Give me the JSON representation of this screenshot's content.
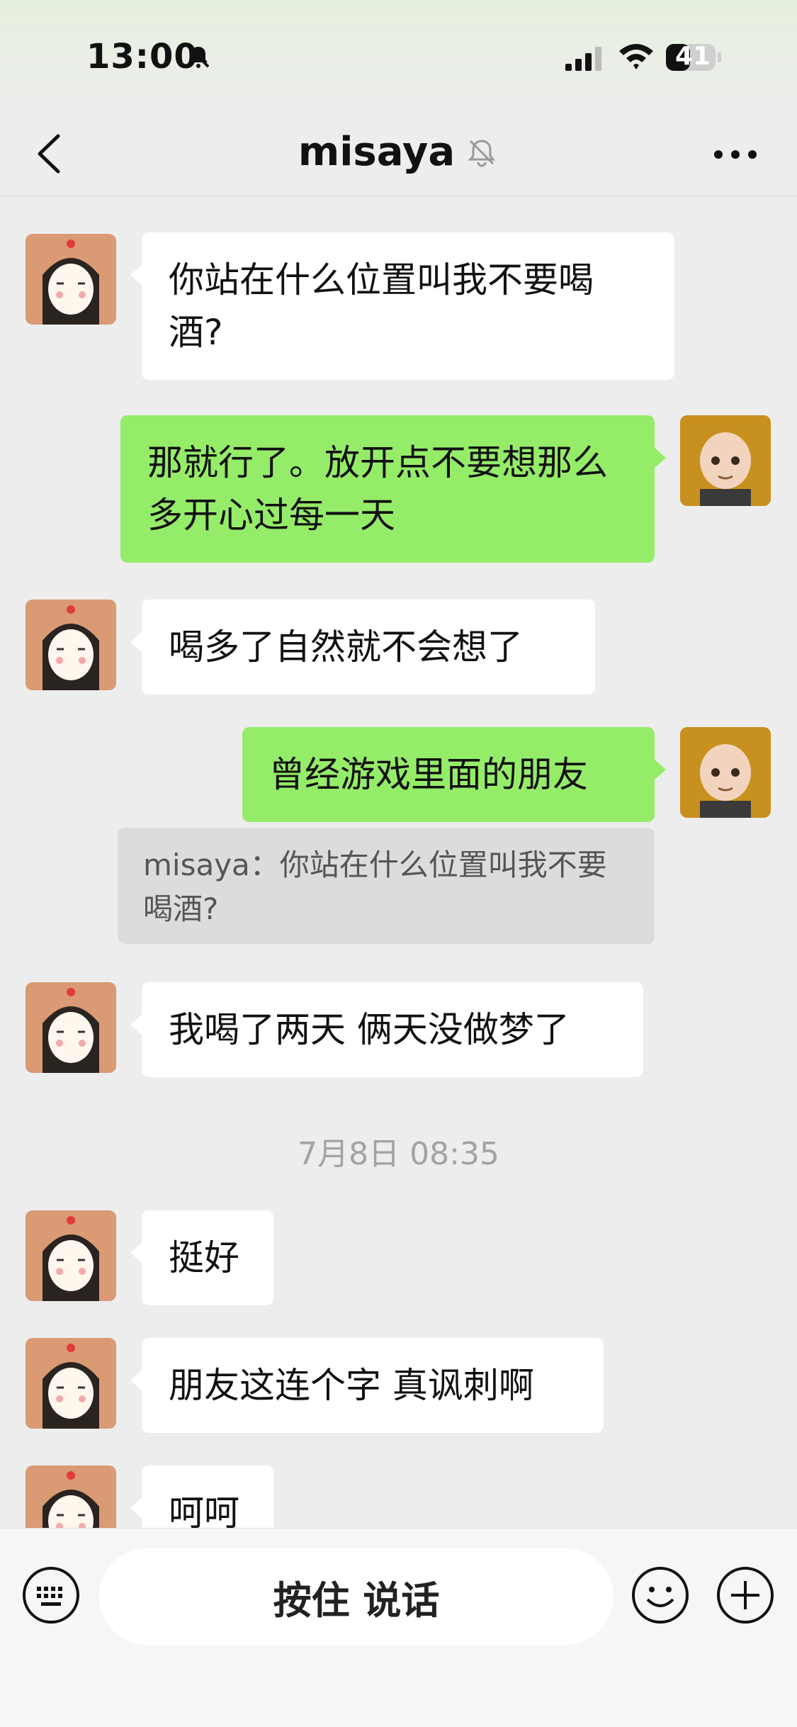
{
  "status_bar": {
    "time": "13:00",
    "battery": "41"
  },
  "header": {
    "title": "misaya"
  },
  "messages": [
    {
      "side": "left",
      "text": "你站在什么位置叫我不要喝酒?"
    },
    {
      "side": "right",
      "text": "那就行了。放开点不要想那么多开心过每一天"
    },
    {
      "side": "left",
      "text": "喝多了自然就不会想了"
    },
    {
      "side": "right",
      "text": "曾经游戏里面的朋友"
    },
    {
      "quote": "misaya：你站在什么位置叫我不要喝酒?"
    },
    {
      "side": "left",
      "text": "我喝了两天 俩天没做梦了"
    },
    {
      "timestamp": "7月8日 08:35"
    },
    {
      "side": "left",
      "text": "挺好"
    },
    {
      "side": "left",
      "text": "朋友这连个字 真讽刺啊"
    },
    {
      "side": "left",
      "text": "呵呵"
    }
  ],
  "input_bar": {
    "talk_label": "按住 说话"
  },
  "colors": {
    "self_bubble": "#95ec69",
    "other_bubble": "#ffffff",
    "background": "#ededed"
  },
  "icons": [
    "back-arrow-icon",
    "mute-icon",
    "more-icon",
    "keyboard-icon",
    "emoji-icon",
    "plus-icon"
  ]
}
